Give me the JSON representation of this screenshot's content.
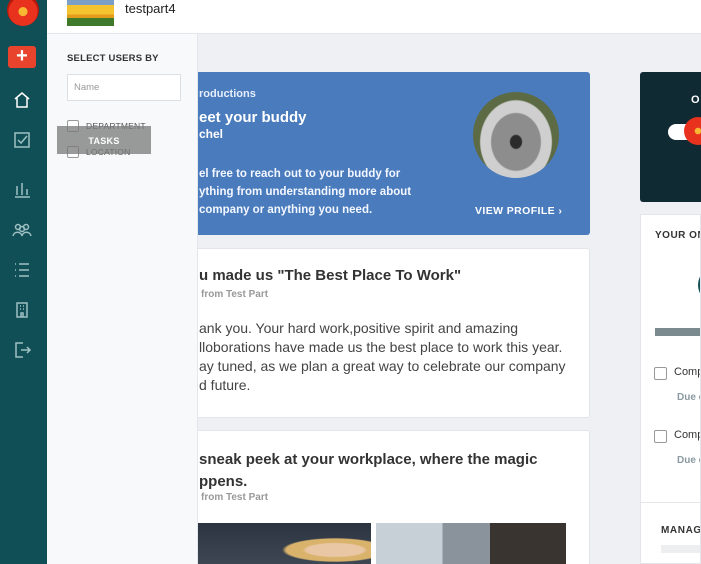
{
  "app": {
    "user_name": "testpart4",
    "add_label": "+"
  },
  "rail": {
    "items": [
      {
        "icon": "home-icon",
        "active": true
      },
      {
        "icon": "tasks-icon"
      },
      {
        "icon": "analytics-icon"
      },
      {
        "icon": "people-icon"
      },
      {
        "icon": "list-icon"
      },
      {
        "icon": "building-icon"
      },
      {
        "icon": "logout-icon"
      }
    ]
  },
  "filter": {
    "title": "SELECT USERS BY",
    "name_placeholder": "Name",
    "options": [
      "DEPARTMENT",
      "LOCATION"
    ],
    "tooltip": "TASKS"
  },
  "buddy_card": {
    "label": "roductions",
    "title": "eet your buddy",
    "name": "chel",
    "description_lines": [
      "el free to reach out to your buddy for",
      "ything from understanding more about",
      " company or anything you need."
    ],
    "view_label": "VIEW PROFILE ›"
  },
  "posts": [
    {
      "title": "u made us \"The Best Place To Work\"",
      "from": "from Test Part",
      "body_lines": [
        "ank you. Your hard work,positive spirit and amazing",
        "lloborations have made us the best place to work this year.",
        "ay tuned, as we plan a great way to celebrate our company",
        "d future."
      ]
    },
    {
      "title_lines": [
        "sneak peek at your workplace, where the magic",
        "ppens."
      ],
      "from": "from Test Part"
    }
  ],
  "right": {
    "top_label": "O",
    "panel_title": "YOUR ON",
    "tasks": [
      {
        "label": "Comp",
        "due": "Due o"
      },
      {
        "label": "Comp",
        "due": "Due o"
      }
    ],
    "manage_title": "MANAG"
  }
}
